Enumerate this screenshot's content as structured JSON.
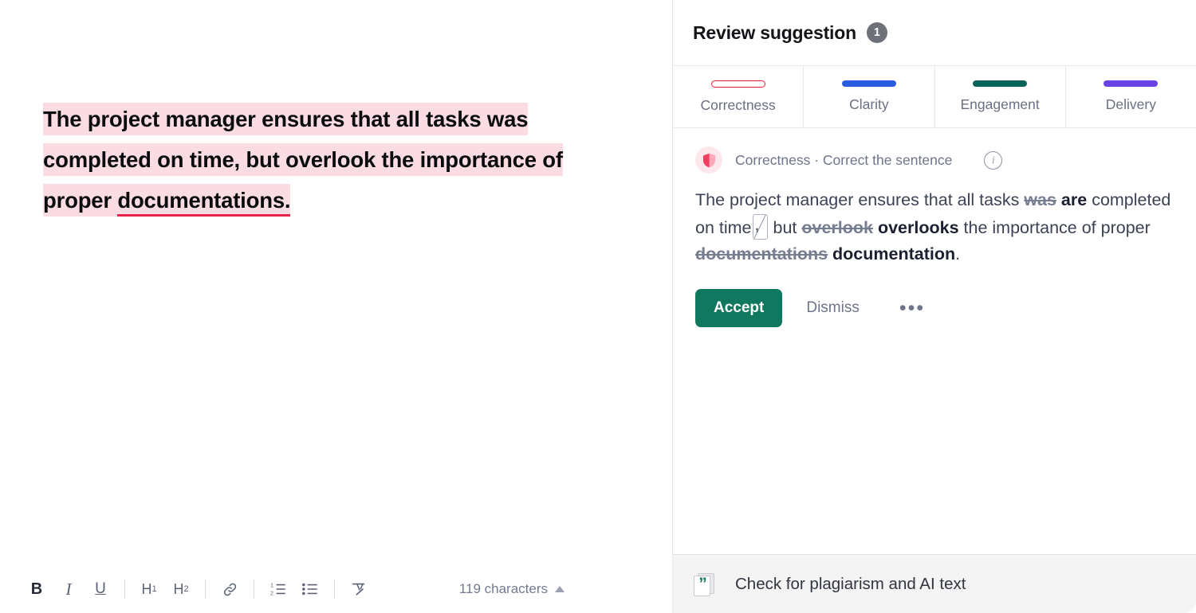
{
  "editor": {
    "document": {
      "segments": [
        {
          "text": "The project manager ensures that all tasks was completed on time, but overlook the importance of proper ",
          "style": "highlight"
        },
        {
          "text": "documentations.",
          "style": "highlight-error-underline"
        }
      ],
      "line1": "The project manager ensures that all tasks",
      "line2": "was completed on time, but overlook the",
      "line3_plain": "importance of proper ",
      "line3_error": "documentations."
    },
    "toolbar": {
      "bold_label": "B",
      "italic_label": "I",
      "underline_label": "U",
      "h1_label": "H",
      "h1_sub": "1",
      "h2_label": "H",
      "h2_sub": "2",
      "link_icon": "link-icon",
      "ordered_list_icon": "ordered-list-icon",
      "bullet_list_icon": "bullet-list-icon",
      "clear_format_icon": "clear-formatting-icon",
      "char_count_label": "119 characters",
      "char_count_caret": "caret-up-icon"
    }
  },
  "sidebar": {
    "header": {
      "title": "Review suggestion",
      "count": "1"
    },
    "tabs": [
      {
        "label": "Correctness",
        "color": "#f01c35",
        "active": true
      },
      {
        "label": "Clarity",
        "color": "#2b5ce0",
        "active": false
      },
      {
        "label": "Engagement",
        "color": "#096356",
        "active": false
      },
      {
        "label": "Delivery",
        "color": "#6a41e3",
        "active": false
      }
    ],
    "suggestion": {
      "category_icon": "shield-icon",
      "category_label": "Correctness · Correct the sentence",
      "info_icon": "info-icon",
      "text_parts": [
        {
          "text": "The project manager ensures that all tasks ",
          "style": "plain"
        },
        {
          "text": "was",
          "style": "deleted"
        },
        {
          "text": " ",
          "style": "plain"
        },
        {
          "text": "are",
          "style": "inserted"
        },
        {
          "text": " completed on time",
          "style": "plain"
        },
        {
          "text": ",",
          "style": "inserted-comma-box"
        },
        {
          "text": " but ",
          "style": "plain"
        },
        {
          "text": "overlook",
          "style": "deleted"
        },
        {
          "text": " ",
          "style": "plain"
        },
        {
          "text": "overlooks",
          "style": "inserted"
        },
        {
          "text": " the importance of proper ",
          "style": "plain"
        },
        {
          "text": "documentations",
          "style": "deleted"
        },
        {
          "text": " ",
          "style": "plain"
        },
        {
          "text": "documentation",
          "style": "inserted"
        },
        {
          "text": ".",
          "style": "plain"
        }
      ],
      "p1": "The project manager ensures that all tasks ",
      "del1": "was",
      "ins1": "are",
      "p2": " completed on time",
      "p3": " but ",
      "del2": "overlook",
      "ins2": "overlooks",
      "p4": " the importance of proper ",
      "del3": "documentations",
      "ins3": "documentation",
      "p5": ".",
      "accept_label": "Accept",
      "dismiss_label": "Dismiss",
      "more_label": "•••"
    },
    "footer": {
      "icon": "plagiarism-quote-icon",
      "quote_glyph": "”",
      "label": "Check for plagiarism and AI text"
    }
  }
}
